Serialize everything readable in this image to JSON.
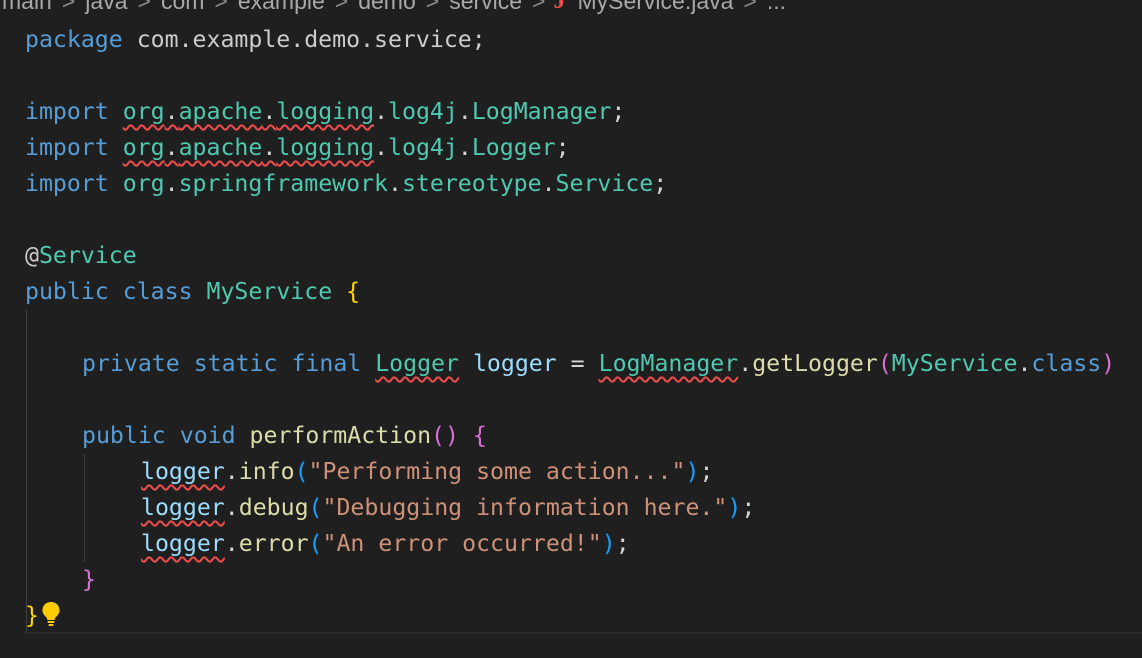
{
  "breadcrumb": {
    "items": [
      "main",
      "java",
      "com",
      "example",
      "demo",
      "service"
    ],
    "file_name": "MyService.java",
    "java_icon_glyph": "J",
    "overflow": "...",
    "separator": ">"
  },
  "code": {
    "line1": {
      "kw": "package",
      "rest": " com.example.demo.service;"
    },
    "line3": {
      "kw": "import",
      "a": "org",
      "b": "apache",
      "c": "logging",
      "d": "log4j",
      "e": "LogManager",
      "end": ";"
    },
    "line4": {
      "kw": "import",
      "a": "org",
      "b": "apache",
      "c": "logging",
      "d": "log4j",
      "e": "Logger",
      "end": ";"
    },
    "line5": {
      "kw": "import",
      "a": "org",
      "b": "springframework",
      "c": "stereotype",
      "d": "Service",
      "end": ";"
    },
    "line7": {
      "at": "@",
      "name": "Service"
    },
    "line8": {
      "kw1": "public",
      "kw2": "class",
      "name": "MyService",
      "brace": "{"
    },
    "line10": {
      "kw1": "private",
      "kw2": "static",
      "kw3": "final",
      "type": "Logger",
      "var": "logger",
      "eq": " = ",
      "cls": "LogManager",
      "dot": ".",
      "fn": "getLogger",
      "paren": "(",
      "arg": "MyService",
      "dot2": ".",
      "kwclass": "class",
      "close": ")"
    },
    "line12": {
      "kw1": "public",
      "kw2": "void",
      "fn": "performAction",
      "parens": "()",
      "brace": "{"
    },
    "line13": {
      "var": "logger",
      "dot": ".",
      "fn": "info",
      "open": "(",
      "str": "\"Performing some action...\"",
      "close": ")",
      "end": ";"
    },
    "line14": {
      "var": "logger",
      "dot": ".",
      "fn": "debug",
      "open": "(",
      "str": "\"Debugging information here.\"",
      "close": ")",
      "end": ";"
    },
    "line15": {
      "var": "logger",
      "dot": ".",
      "fn": "error",
      "open": "(",
      "str": "\"An error occurred!\"",
      "close": ")",
      "end": ";"
    },
    "line16": {
      "brace": "}"
    },
    "line17": {
      "brace": "}"
    }
  },
  "colors": {
    "background": "#1f1f1f",
    "keyword": "#569cd6",
    "type": "#4ec9b0",
    "variable": "#9cdcfe",
    "function": "#dcdcaa",
    "string": "#ce9178",
    "error_squiggle": "#f14c4c",
    "bracket_gold": "#ffd700",
    "bracket_pink": "#da70d6",
    "bracket_blue": "#179fff",
    "lightbulb": "#ffcc00"
  },
  "icons": {
    "java_file": "java-file-icon",
    "lightbulb": "lightbulb-icon"
  }
}
